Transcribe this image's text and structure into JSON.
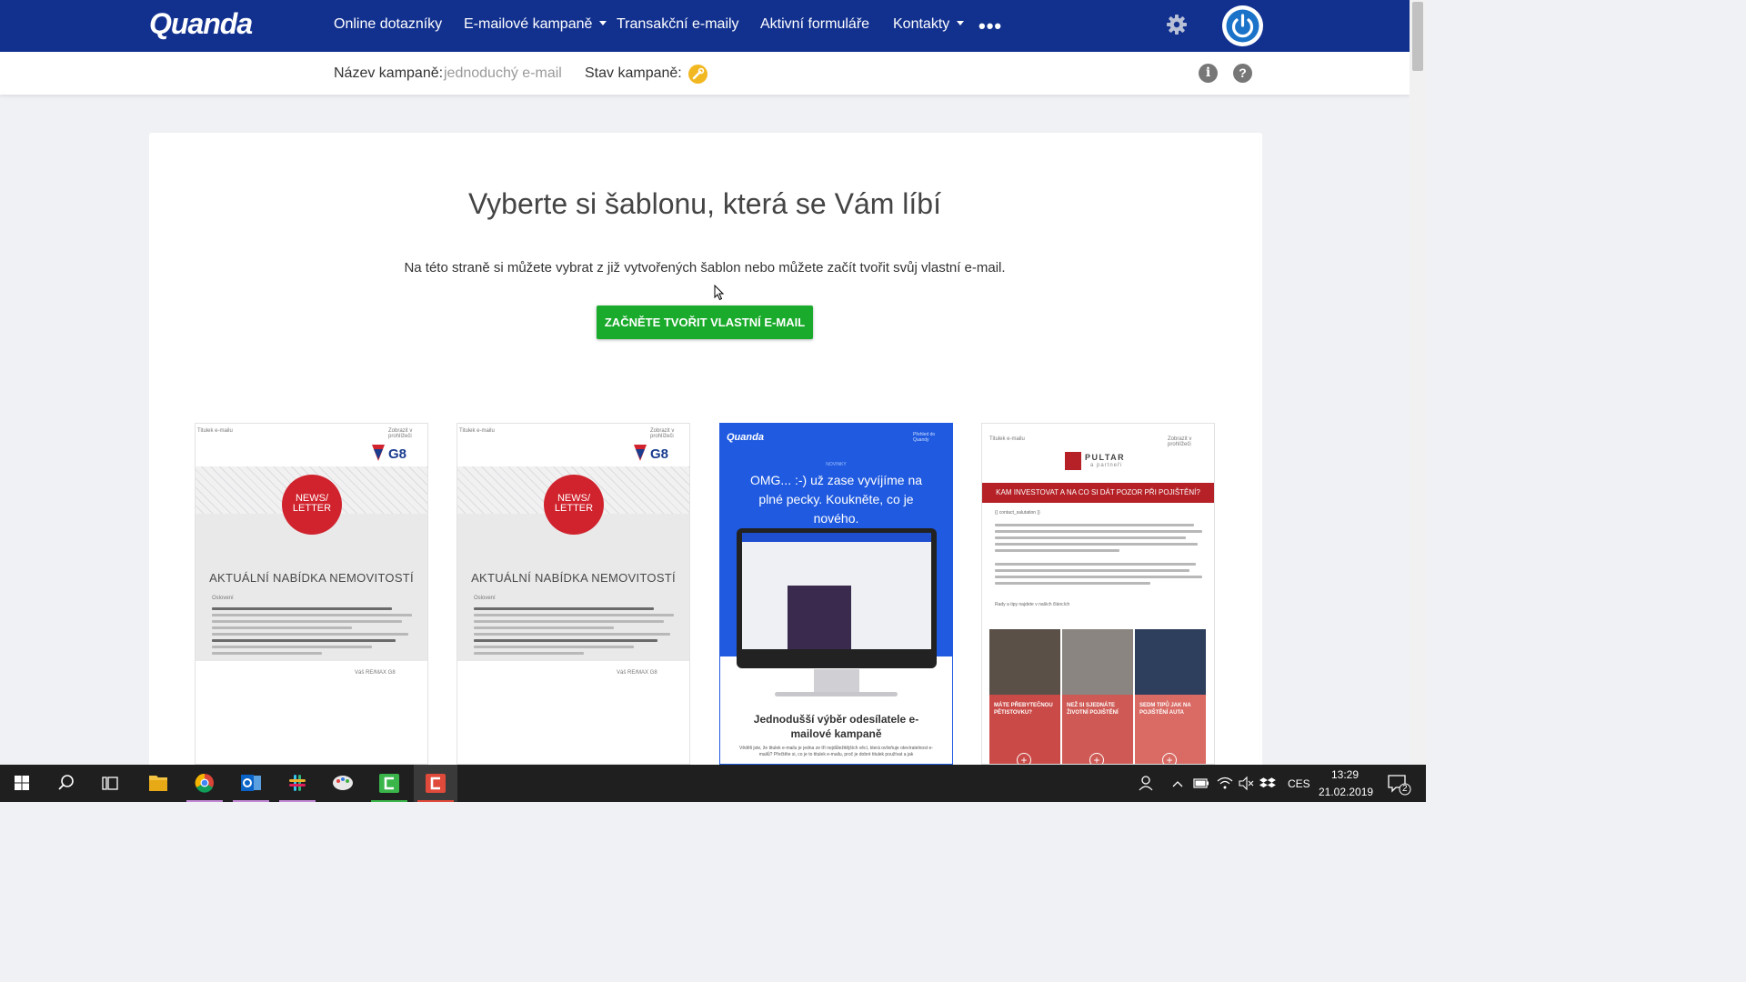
{
  "brand": {
    "name": "Quanda"
  },
  "nav": {
    "items": [
      {
        "label": "Online dotazníky"
      },
      {
        "label": "E-mailové kampaně"
      },
      {
        "label": "Transakční e-maily"
      },
      {
        "label": "Aktivní formuláře"
      },
      {
        "label": "Kontakty"
      }
    ],
    "more": "•••"
  },
  "campaign": {
    "name_label": "Název kampaně:",
    "name_value": "jednoduchý e-mail",
    "status_label": "Stav kampaně:"
  },
  "main": {
    "title": "Vyberte si šablonu, která se Vám líbí",
    "subtitle": "Na této straně si můžete vybrat z již vytvořených šablon nebo můžete začít tvořit svůj vlastní e-mail.",
    "cta": "ZAČNĚTE TVOŘIT VLASTNÍ E-MAIL"
  },
  "templates": [
    {
      "header_left": "Titulek e-mailu",
      "header_right": "Zobrazit v prohlížeči",
      "brand": "G8",
      "badge": "NEWS/ LETTER",
      "heading": "AKTUÁLNÍ NABÍDKA NEMOVITOSTÍ",
      "greeting": "Oslovení",
      "signature": "Váš RE/MAX G8"
    },
    {
      "header_left": "Titulek e-mailu",
      "header_right": "Zobrazit v prohlížeči",
      "brand": "G8",
      "badge": "NEWS/ LETTER",
      "heading": "AKTUÁLNÍ NABÍDKA NEMOVITOSTÍ",
      "greeting": "Oslovení",
      "signature": "Váš RE/MAX G8"
    },
    {
      "brand": "Quanda",
      "header_right": "Přehled do Quandy",
      "kicker": "NOVINKY",
      "heading": "OMG... :-) už zase vyvíjíme na plné pecky. Koukněte, co je nového.",
      "caption": "Jednodušší výběr odesílatele e-mailové kampaně",
      "body": "Věděli jste, že titulek e-mailu je jedna ze tří nejdůležitějších věcí, která ovlivňuje otevíratelnost e-mailů? Přečtěte si, co je to titulek e-mailu, proč je dobré titulek používat a jak"
    },
    {
      "header_left": "Titulek e-mailu",
      "header_right": "Zobrazit v prohlížeči",
      "brand": "PULTAR",
      "brand_sub": "a partneři",
      "banner": "KAM INVESTOVAT A NA CO SI DÁT POZOR PŘI POJIŠTĚNÍ?",
      "salutation": "{{ contact_salutation }}",
      "closing": "Rady a tipy najdete v našich článcích",
      "columns": [
        {
          "title": "MÁTE PŘEBYTEČNOU PĚTISTOVKU?"
        },
        {
          "title": "NEŽ SI SJEDNÁTE ŽIVOTNÍ POJIŠTĚNÍ"
        },
        {
          "title": "SEDM TIPŮ JAK NA POJIŠTĚNÍ AUTA"
        }
      ]
    }
  ],
  "taskbar": {
    "language": "CES",
    "time": "13:29",
    "date": "21.02.2019",
    "notifications": "2"
  },
  "colors": {
    "nav_bg": "#12318f",
    "cta_bg": "#1bab2c",
    "status_badge": "#f2b822",
    "remax_red": "#d0232d",
    "pultar_red": "#b52126"
  },
  "icons": {
    "settings": "gear-icon",
    "account": "power-icon",
    "info": "info-icon",
    "help": "help-icon",
    "status": "wrench-icon"
  }
}
